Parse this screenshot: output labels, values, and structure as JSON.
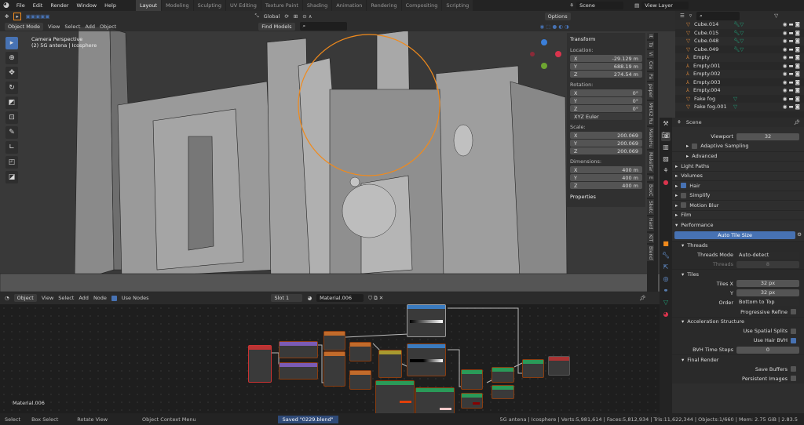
{
  "menu": [
    "File",
    "Edit",
    "Render",
    "Window",
    "Help"
  ],
  "workspaces": [
    "Layout",
    "Modeling",
    "Sculpting",
    "UV Editing",
    "Texture Paint",
    "Shading",
    "Animation",
    "Rendering",
    "Compositing",
    "Scripting"
  ],
  "active_workspace": "Layout",
  "scene": "Scene",
  "view_layer": "View Layer",
  "viewport": {
    "mode": "Object Mode",
    "menus": [
      "View",
      "Select",
      "Add",
      "Object"
    ],
    "orientation": "Global",
    "find_models": "Find Models",
    "options": "Options",
    "overlay_title": "Camera Perspective",
    "overlay_object": "(2) 5G antena | Icosphere"
  },
  "npanel": {
    "transform": "Transform",
    "location_label": "Location:",
    "location": [
      [
        "X",
        "-29.129 m"
      ],
      [
        "Y",
        "688.19 m"
      ],
      [
        "Z",
        "274.54 m"
      ]
    ],
    "rotation_label": "Rotation:",
    "rotation": [
      [
        "X",
        "0°"
      ],
      [
        "Y",
        "0°"
      ],
      [
        "Z",
        "0°"
      ]
    ],
    "rotation_mode": "XYZ Euler",
    "scale_label": "Scale:",
    "scale": [
      [
        "X",
        "200.069"
      ],
      [
        "Y",
        "200.069"
      ],
      [
        "Z",
        "200.069"
      ]
    ],
    "dimensions_label": "Dimensions:",
    "dimensions": [
      [
        "X",
        "400 m"
      ],
      [
        "Y",
        "400 m"
      ],
      [
        "Z",
        "400 m"
      ]
    ],
    "properties": "Properties",
    "tabs": [
      "It",
      "To",
      "Vi",
      "Cre",
      "Pa",
      "paper",
      "MHX2 Ru",
      "MakeHu",
      "MakeTar",
      "E",
      "BoxC",
      "Sketc",
      "Hard",
      "KIT",
      "Blend"
    ]
  },
  "outliner": {
    "items": [
      {
        "name": "Cube.014",
        "type": "mesh"
      },
      {
        "name": "Cube.015",
        "type": "mesh"
      },
      {
        "name": "Cube.048",
        "type": "mesh"
      },
      {
        "name": "Cube.049",
        "type": "mesh"
      },
      {
        "name": "Empty",
        "type": "empty"
      },
      {
        "name": "Empty.001",
        "type": "empty"
      },
      {
        "name": "Empty.002",
        "type": "empty"
      },
      {
        "name": "Empty.003",
        "type": "empty"
      },
      {
        "name": "Empty.004",
        "type": "empty"
      },
      {
        "name": "Fake fog",
        "type": "mesh"
      },
      {
        "name": "Fake fog.001",
        "type": "mesh"
      }
    ]
  },
  "properties": {
    "scene": "Scene",
    "viewport_label": "Viewport",
    "viewport_value": "32",
    "adaptive_sampling": "Adaptive Sampling",
    "advanced": "Advanced",
    "light_paths": "Light Paths",
    "volumes": "Volumes",
    "hair": "Hair",
    "simplify": "Simplify",
    "motion_blur": "Motion Blur",
    "film": "Film",
    "performance": "Performance",
    "auto_tile": "Auto Tile Size",
    "threads": "Threads",
    "threads_mode_label": "Threads Mode",
    "threads_mode": "Auto-detect",
    "threads_label": "Threads",
    "threads_value": "8",
    "tiles": "Tiles",
    "tiles_x_label": "Tiles X",
    "tiles_x": "32 px",
    "tiles_y_label": "Y",
    "tiles_y": "32 px",
    "order_label": "Order",
    "order": "Bottom to Top",
    "progressive": "Progressive Refine",
    "accel": "Acceleration Structure",
    "spatial": "Use Spatial Splits",
    "hair_bvh": "Use Hair BVH",
    "bvh_steps_label": "BVH Time Steps",
    "bvh_steps": "0",
    "final_render": "Final Render",
    "save_buffers": "Save Buffers",
    "persistent": "Persistent Images"
  },
  "node_editor": {
    "type": "Object",
    "menus": [
      "View",
      "Select",
      "Add",
      "Node"
    ],
    "use_nodes": "Use Nodes",
    "slot": "Slot 1",
    "material": "Material.006",
    "label": "Material.006"
  },
  "status": {
    "select": "Select",
    "box_select": "Box Select",
    "rotate": "Rotate View",
    "context": "Object Context Menu",
    "saved": "Saved \"0229.blend\"",
    "stats": "5G antena | Icosphere | Verts:5,981,614 | Faces:5,812,934 | Tris:11,622,344 | Objects:1/660 | Mem: 2.75 GiB | 2.83.5"
  },
  "colors": {
    "accent": "#4772b3",
    "selection": "#f08a1c",
    "mesh_icon": "#e08a3a",
    "modifier_icon": "#1fa37a"
  }
}
